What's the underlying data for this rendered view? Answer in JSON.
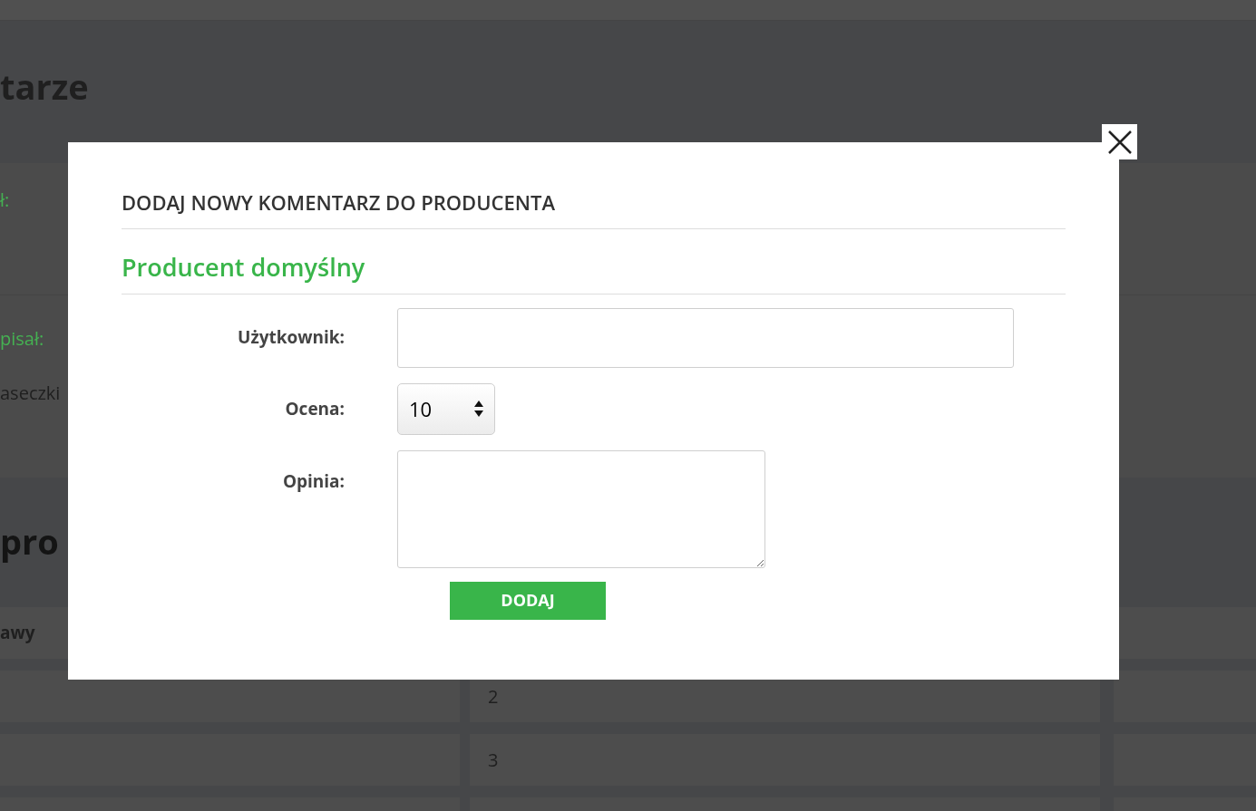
{
  "background": {
    "heading": "tarze",
    "bands": [
      {
        "kind": "label",
        "text": "ł:"
      },
      {
        "kind": "label",
        "text": "pisał:",
        "body": "aseczki"
      }
    ],
    "section_heading": "pro",
    "table": {
      "header": "awy",
      "rows": [
        {
          "column_2": "2"
        },
        {
          "column_2": "3"
        }
      ]
    }
  },
  "modal": {
    "title": "DODAJ NOWY KOMENTARZ DO PRODUCENTA",
    "subtitle": "Producent domyślny",
    "fields": [
      {
        "kind": "text",
        "label": "Użytkownik:"
      },
      {
        "kind": "select",
        "label": "Ocena:",
        "value": "10"
      },
      {
        "kind": "textarea",
        "label": "Opinia:"
      }
    ],
    "submit": "DODAJ"
  }
}
